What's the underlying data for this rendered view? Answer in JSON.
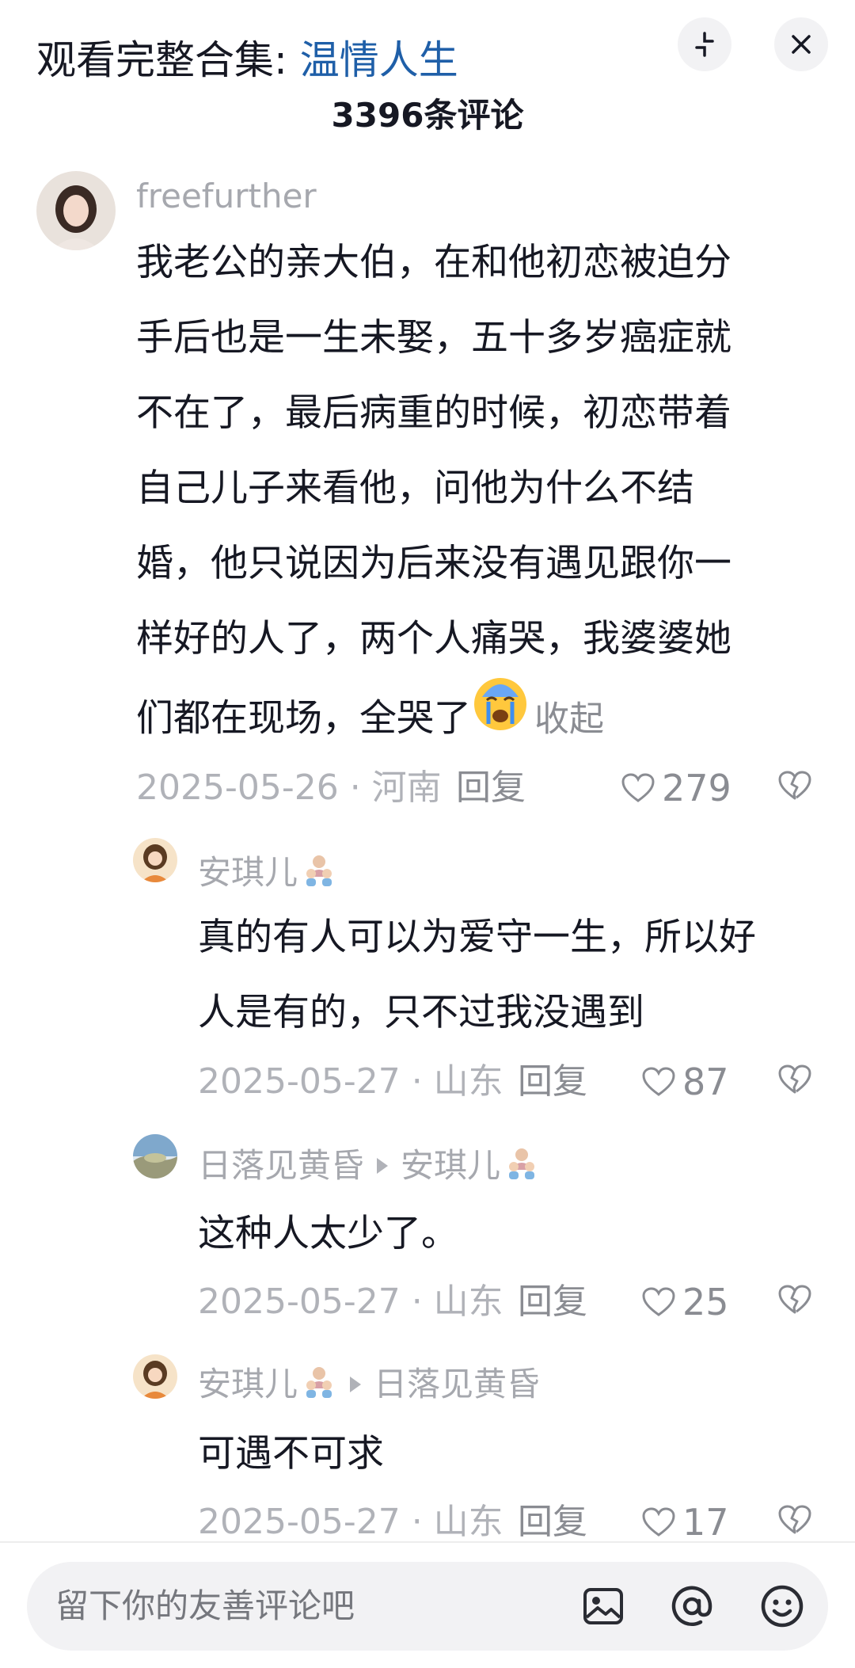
{
  "header": {
    "collection_prefix": "观看完整合集: ",
    "collection_name": "温情人生",
    "comment_count_title": "3396条评论"
  },
  "main_comment": {
    "username": "freefurther",
    "lines": [
      "我老公的亲大伯，在和他初恋被迫分",
      "手后也是一生未娶，五十多岁癌症就",
      "不在了，最后病重的时候，初恋带着",
      "自己儿子来看他，问他为什么不结",
      "婚，他只说因为后来没有遇见跟你一",
      "样好的人了，两个人痛哭，我婆婆她",
      "们都在现场，全哭了"
    ],
    "emoji": "crying-face",
    "collapse_label": "收起",
    "meta": "2025-05-26 · 河南",
    "reply_label": "回复",
    "likes": "279"
  },
  "replies": [
    {
      "username": "安琪儿",
      "reply_to": "",
      "lines": [
        "真的有人可以为爱守一生，所以好",
        "人是有的，只不过我没遇到"
      ],
      "meta": "2025-05-27 · 山东",
      "reply_label": "回复",
      "likes": "87"
    },
    {
      "username": "日落见黄昏",
      "reply_to": "安琪儿",
      "lines": [
        "这种人太少了。"
      ],
      "meta": "2025-05-27 · 山东",
      "reply_label": "回复",
      "likes": "25"
    },
    {
      "username": "安琪儿",
      "reply_to": "日落见黄昏",
      "lines": [
        "可遇不可求"
      ],
      "meta": "2025-05-27 · 山东",
      "reply_label": "回复",
      "likes": "17"
    }
  ],
  "input": {
    "placeholder": "留下你的友善评论吧"
  },
  "icons": {
    "minimize": "minimize-icon",
    "close": "close-icon",
    "like": "heart-icon",
    "dislike": "broken-heart-icon",
    "image": "image-icon",
    "mention": "at-icon",
    "emoji": "emoji-icon"
  }
}
